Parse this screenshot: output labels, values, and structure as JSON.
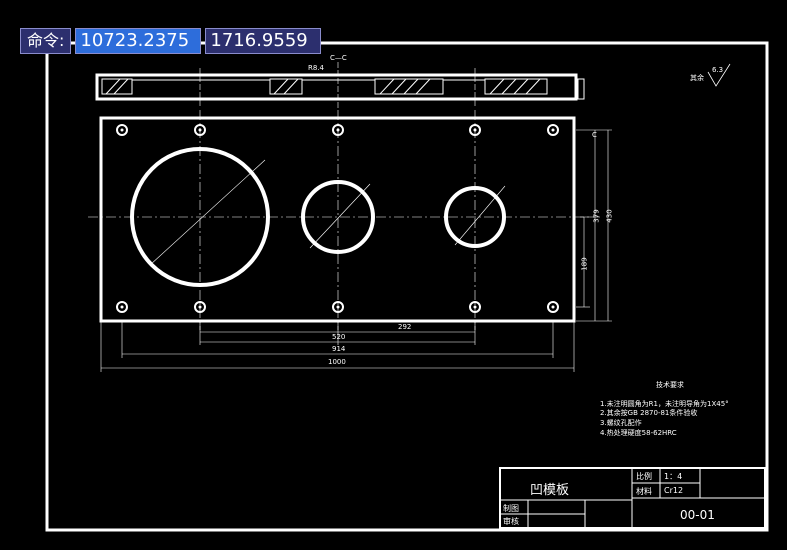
{
  "command_line": {
    "label": "命令:",
    "x_value": "10723.2375",
    "y_value": "1716.9559"
  },
  "drawing": {
    "section_label": "C—C",
    "dim_r8": "R8.4",
    "roughness_label": "其余",
    "roughness_value": "6.3",
    "dimensions": {
      "d520": "520",
      "d292": "292",
      "d914": "914",
      "d1000": "1000",
      "d379": "379",
      "d430": "430",
      "d189": "189",
      "c_mark": "C"
    },
    "tech_requirements": {
      "title": "技术要求",
      "items": [
        "1.未注明圆角为R1，未注明导角为1X45°",
        "2.其余按GB 2870-81条件验收",
        "3.螺纹孔配作",
        "4.热处理硬度58-62HRC"
      ]
    },
    "title_block": {
      "part_name": "凹模板",
      "scale_label": "比例",
      "scale_value": "1：4",
      "material_label": "材料",
      "material_value": "Cr12",
      "drawn_label": "制图",
      "checked_label": "审核",
      "drawing_number": "00-01"
    }
  }
}
